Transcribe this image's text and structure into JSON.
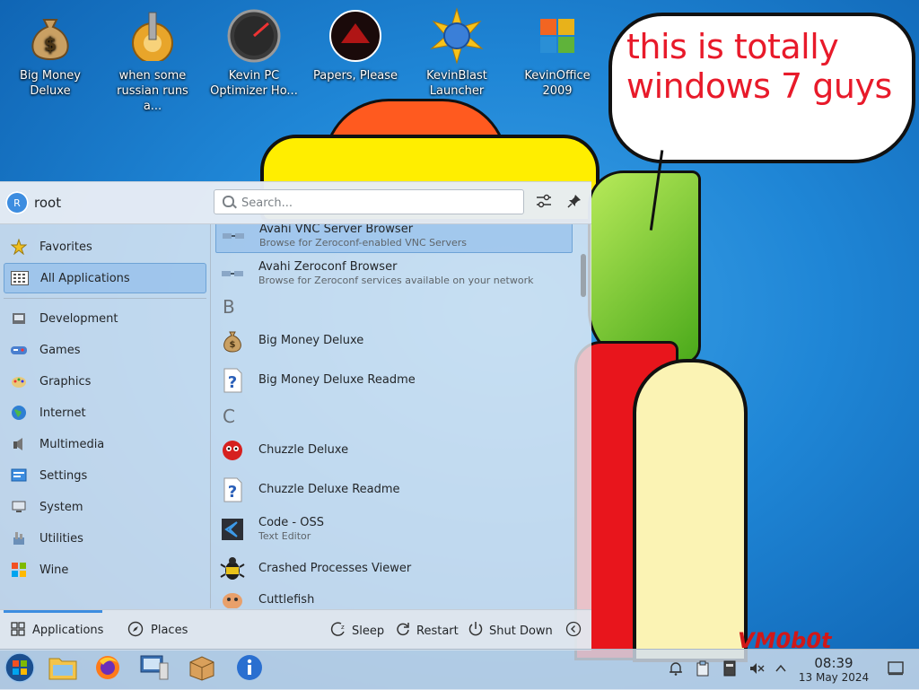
{
  "desktop": {
    "icons": [
      {
        "label": "Big Money Deluxe",
        "icon": "money-bag-icon"
      },
      {
        "label": "when some russian runs a...",
        "icon": "gear-icon"
      },
      {
        "label": "Kevin PC Optimizer Ho...",
        "icon": "speedometer-icon"
      },
      {
        "label": "Papers, Please",
        "icon": "papers-please-icon"
      },
      {
        "label": "KevinBlast Launcher",
        "icon": "globe-burst-icon"
      },
      {
        "label": "KevinOffice 2009",
        "icon": "office-logo-icon"
      }
    ],
    "bubble_text": "this is totally windows 7 guys",
    "watermark": "VM0b0t"
  },
  "launcher": {
    "user": {
      "initial": "R",
      "name": "root"
    },
    "search_placeholder": "Search...",
    "categories": [
      {
        "label": "Favorites",
        "icon": "star-icon"
      },
      {
        "label": "All Applications",
        "icon": "grid-icon",
        "selected": true
      },
      {
        "label": "Development",
        "icon": "development-icon"
      },
      {
        "label": "Games",
        "icon": "games-icon"
      },
      {
        "label": "Graphics",
        "icon": "graphics-icon"
      },
      {
        "label": "Internet",
        "icon": "internet-icon"
      },
      {
        "label": "Multimedia",
        "icon": "multimedia-icon"
      },
      {
        "label": "Settings",
        "icon": "settings-icon"
      },
      {
        "label": "System",
        "icon": "system-icon"
      },
      {
        "label": "Utilities",
        "icon": "utilities-icon"
      },
      {
        "label": "Wine",
        "icon": "wine-icon"
      }
    ],
    "apps": [
      {
        "name": "Avahi VNC Server Browser",
        "desc": "Browse for Zeroconf-enabled VNC Servers",
        "icon": "network-icon",
        "selected": true
      },
      {
        "name": "Avahi Zeroconf Browser",
        "desc": "Browse for Zeroconf services available on your network",
        "icon": "network-icon"
      },
      {
        "name": "Big Money Deluxe",
        "desc": "",
        "icon": "money-bag-icon"
      },
      {
        "name": "Big Money Deluxe Readme",
        "desc": "",
        "icon": "help-icon"
      },
      {
        "name": "Chuzzle Deluxe",
        "desc": "",
        "icon": "chuzzle-icon"
      },
      {
        "name": "Chuzzle Deluxe Readme",
        "desc": "",
        "icon": "help-icon"
      },
      {
        "name": "Code - OSS",
        "desc": "Text Editor",
        "icon": "code-icon"
      },
      {
        "name": "Crashed Processes Viewer",
        "desc": "",
        "icon": "bug-icon"
      },
      {
        "name": "Cuttlefish",
        "desc": "",
        "icon": "cuttlefish-icon"
      }
    ],
    "letters": [
      "B",
      "C"
    ],
    "footer": {
      "tab_applications": "Applications",
      "tab_places": "Places",
      "sleep": "Sleep",
      "restart": "Restart",
      "shutdown": "Shut Down"
    }
  },
  "taskbar": {
    "apps": [
      "start-orb-icon",
      "file-manager-icon",
      "firefox-icon",
      "system-monitor-icon",
      "package-icon",
      "info-icon"
    ],
    "clock_time": "08:39",
    "clock_date": "13 May 2024"
  }
}
